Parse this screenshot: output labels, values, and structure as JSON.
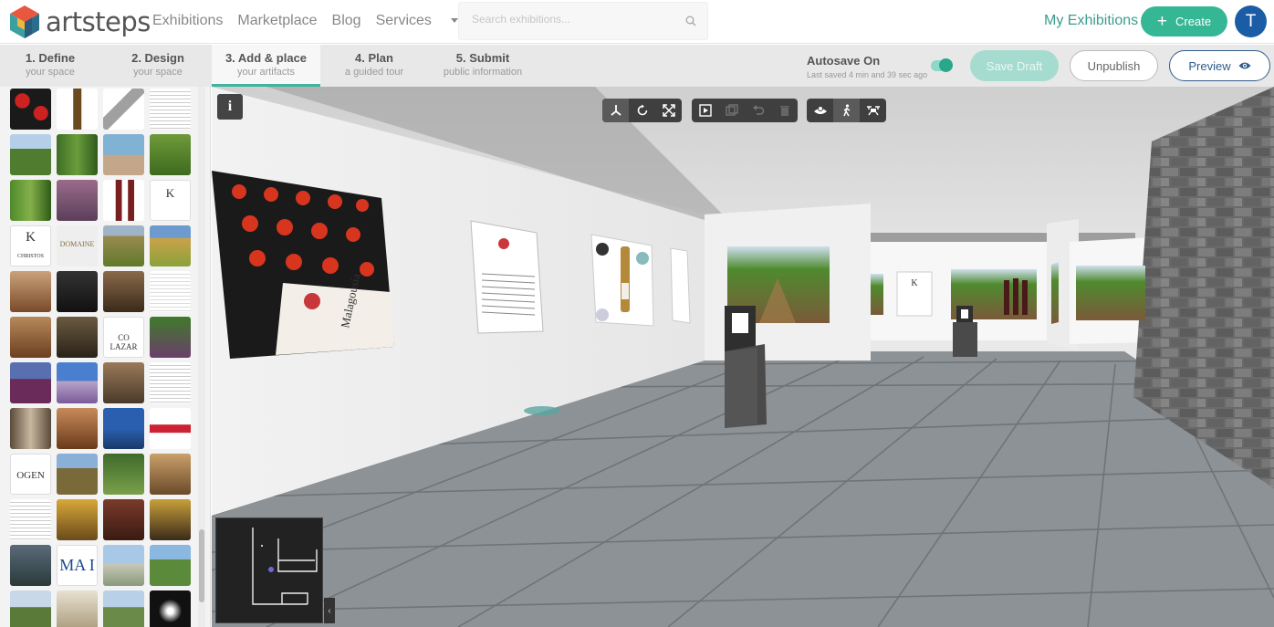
{
  "brand": {
    "name": "artsteps"
  },
  "nav": {
    "links": [
      "Exhibitions",
      "Marketplace",
      "Blog"
    ],
    "services": "Services",
    "search_placeholder": "Search exhibitions...",
    "my_exhibitions": "My Exhibitions",
    "create": "Create",
    "avatar_letter": "T"
  },
  "steps": [
    {
      "title": "1. Define",
      "sub": "your space"
    },
    {
      "title": "2. Design",
      "sub": "your space"
    },
    {
      "title": "3. Add & place",
      "sub": "your artifacts"
    },
    {
      "title": "4. Plan",
      "sub": "a guided tour"
    },
    {
      "title": "5. Submit",
      "sub": "public information"
    }
  ],
  "active_step": 2,
  "autosave": {
    "title": "Autosave On",
    "sub": "Last saved 4 min and 39 sec ago",
    "enabled": true
  },
  "actions": {
    "save_draft": "Save Draft",
    "unpublish": "Unpublish",
    "preview": "Preview"
  },
  "thumb_labels": {
    "christos": "CHRISTOS",
    "domaine": "DOMAINE",
    "lazar": "CO LAZAR",
    "ogen": "OGEN",
    "mat": "MA I"
  },
  "colors": {
    "accent": "#35b796",
    "brand_blue": "#1a5da6",
    "preview": "#2f5d8c"
  },
  "icons": [
    "search-icon",
    "plus-icon",
    "eye-icon",
    "info-icon",
    "axis-icon",
    "rotate-icon",
    "scale-icon",
    "play-tour-icon",
    "copy-icon",
    "undo-icon",
    "delete-icon",
    "top-view-icon",
    "walk-icon",
    "drone-icon",
    "chevron-left-icon"
  ]
}
